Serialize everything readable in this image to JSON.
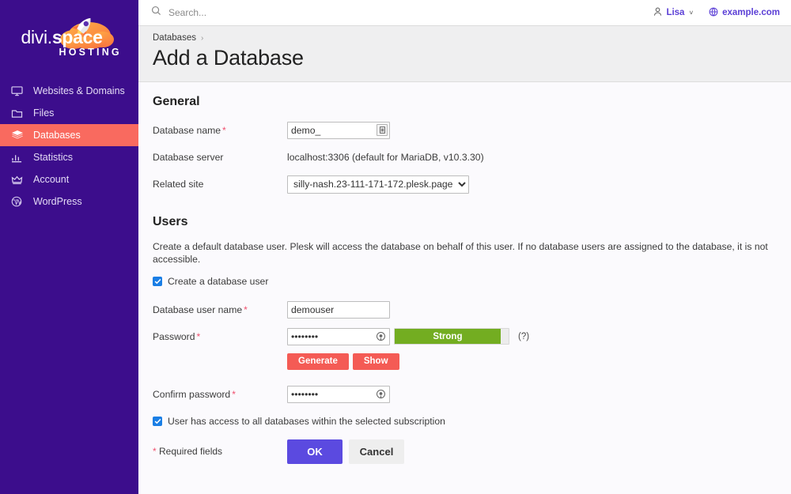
{
  "sidebar": {
    "logo": {
      "text_light": "divi.",
      "text_bold": "space",
      "subtitle": "HOSTING",
      "icon": "rocket-cloud-logo"
    },
    "items": [
      {
        "label": "Websites & Domains",
        "icon": "monitor-icon",
        "active": false
      },
      {
        "label": "Files",
        "icon": "folder-icon",
        "active": false
      },
      {
        "label": "Databases",
        "icon": "database-layers-icon",
        "active": true
      },
      {
        "label": "Statistics",
        "icon": "bar-chart-icon",
        "active": false
      },
      {
        "label": "Account",
        "icon": "crown-icon",
        "active": false
      },
      {
        "label": "WordPress",
        "icon": "wordpress-icon",
        "active": false
      }
    ],
    "collapse_label": "‹",
    "active_color": "#f96a5f",
    "background_color": "#3c0d8c"
  },
  "topbar": {
    "search_placeholder": "Search...",
    "search_value": "",
    "user": {
      "name": "Lisa",
      "icon": "person-icon",
      "caret": "˅"
    },
    "site": {
      "name": "example.com",
      "icon": "globe-icon"
    }
  },
  "header": {
    "breadcrumb": [
      {
        "label": "Databases"
      }
    ],
    "breadcrumb_separator": "›",
    "title": "Add a Database"
  },
  "general": {
    "section_title": "General",
    "database_name": {
      "label": "Database name",
      "required": "*",
      "value": "demo_",
      "picker_icon": "list-picker-icon"
    },
    "database_server": {
      "label": "Database server",
      "value": "localhost:3306 (default for MariaDB, v10.3.30)"
    },
    "related_site": {
      "label": "Related site",
      "selected": "silly-nash.23-111-171-172.plesk.page",
      "options": [
        "silly-nash.23-111-171-172.plesk.page"
      ]
    }
  },
  "users": {
    "section_title": "Users",
    "description": "Create a default database user. Plesk will access the database on behalf of this user. If no database users are assigned to the database, it is not accessible.",
    "create_user_checkbox": {
      "label": "Create a database user",
      "checked": true,
      "mark": "✓"
    },
    "user_name": {
      "label": "Database user name",
      "required": "*",
      "value": "demouser"
    },
    "password": {
      "label": "Password",
      "required": "*",
      "value": "••••••••",
      "reveal_icon": "eye-icon",
      "strength_label": "Strong",
      "strength_percent": 93,
      "strength_color": "#73ad21",
      "help": "(?)"
    },
    "generate_button": "Generate",
    "show_button": "Show",
    "confirm_password": {
      "label": "Confirm password",
      "required": "*",
      "value": "••••••••",
      "reveal_icon": "eye-icon"
    },
    "access_checkbox": {
      "label": "User has access to all databases within the selected subscription",
      "checked": true,
      "mark": "✓"
    }
  },
  "footer": {
    "required_star": "*",
    "required_note": "Required fields",
    "ok_button": "OK",
    "cancel_button": "Cancel"
  }
}
